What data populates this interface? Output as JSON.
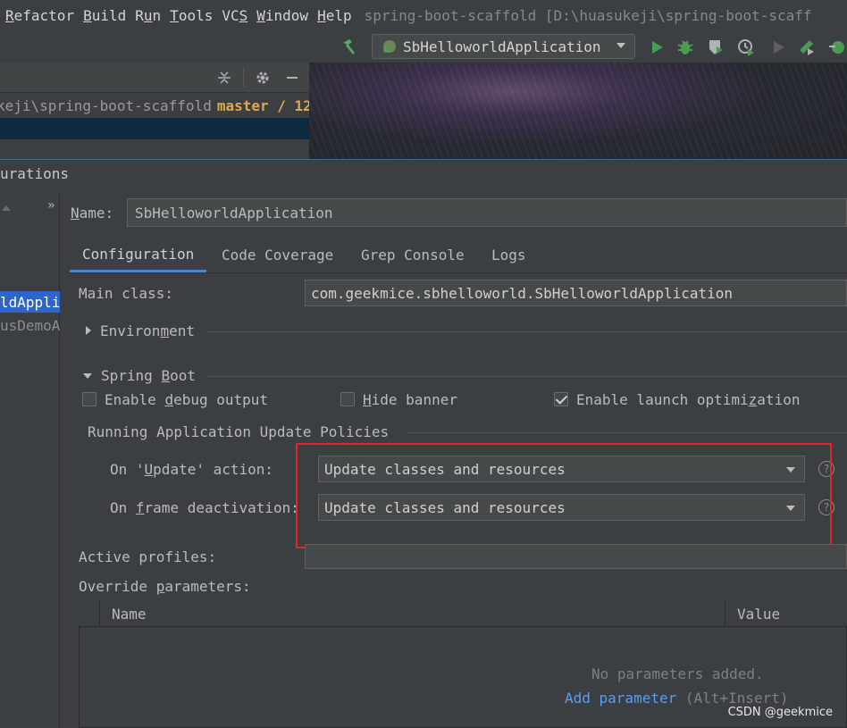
{
  "menubar": {
    "items": [
      {
        "label": "Refactor",
        "mnemonic": "R"
      },
      {
        "label": "Build",
        "mnemonic": "B"
      },
      {
        "label": "Run",
        "mnemonic": "u"
      },
      {
        "label": "Tools",
        "mnemonic": "T"
      },
      {
        "label": "VCS",
        "mnemonic": "S"
      },
      {
        "label": "Window",
        "mnemonic": "W"
      },
      {
        "label": "Help",
        "mnemonic": "H"
      }
    ],
    "window_title": "spring-boot-scaffold [D:\\huasukeji\\spring-boot-scaff"
  },
  "toolbar": {
    "run_config": "SbHelloworldApplication",
    "icons": [
      "hammer-icon",
      "run-icon",
      "debug-icon",
      "coverage-icon",
      "profile-icon",
      "stop-icon",
      "attach-icon",
      "update-icon"
    ]
  },
  "project": {
    "path": "keji\\spring-boot-scaffold",
    "branch": "master / 12"
  },
  "dialog": {
    "title": "urations",
    "list": {
      "selected": "ldApplic",
      "item2": "usDemoA"
    },
    "name_label": "Name:",
    "name_value": "SbHelloworldApplication",
    "tabs": [
      "Configuration",
      "Code Coverage",
      "Grep Console",
      "Logs"
    ],
    "main_class_label": "Main class:",
    "main_class_value": "com.geekmice.sbhelloworld.SbHelloworldApplication",
    "environment_label": "Environment",
    "spring_boot_label": "Spring Boot",
    "checkboxes": [
      {
        "label": "Enable debug output",
        "checked": false
      },
      {
        "label": "Hide banner",
        "checked": false
      },
      {
        "label": "Enable launch optimization",
        "checked": true
      }
    ],
    "policies_label": "Running Application Update Policies",
    "on_update_label": "On 'Update' action:",
    "on_update_value": "Update classes and resources",
    "on_frame_label": "On frame deactivation:",
    "on_frame_value": "Update classes and resources",
    "help_glyph": "?",
    "active_profiles_label": "Active profiles:",
    "active_profiles_value": "",
    "override_label": "Override parameters:",
    "table": {
      "columns": [
        "Name",
        "Value"
      ],
      "empty_text": "No parameters added.",
      "add_link": "Add parameter",
      "add_shortcut": "(Alt+Insert)"
    }
  },
  "watermark": "CSDN @geekmice",
  "colors": {
    "accent": "#4a88c7",
    "selection": "#2f65ca",
    "highlight_box": "#e0252b",
    "branch": "#e0a84a",
    "link": "#589df6"
  }
}
